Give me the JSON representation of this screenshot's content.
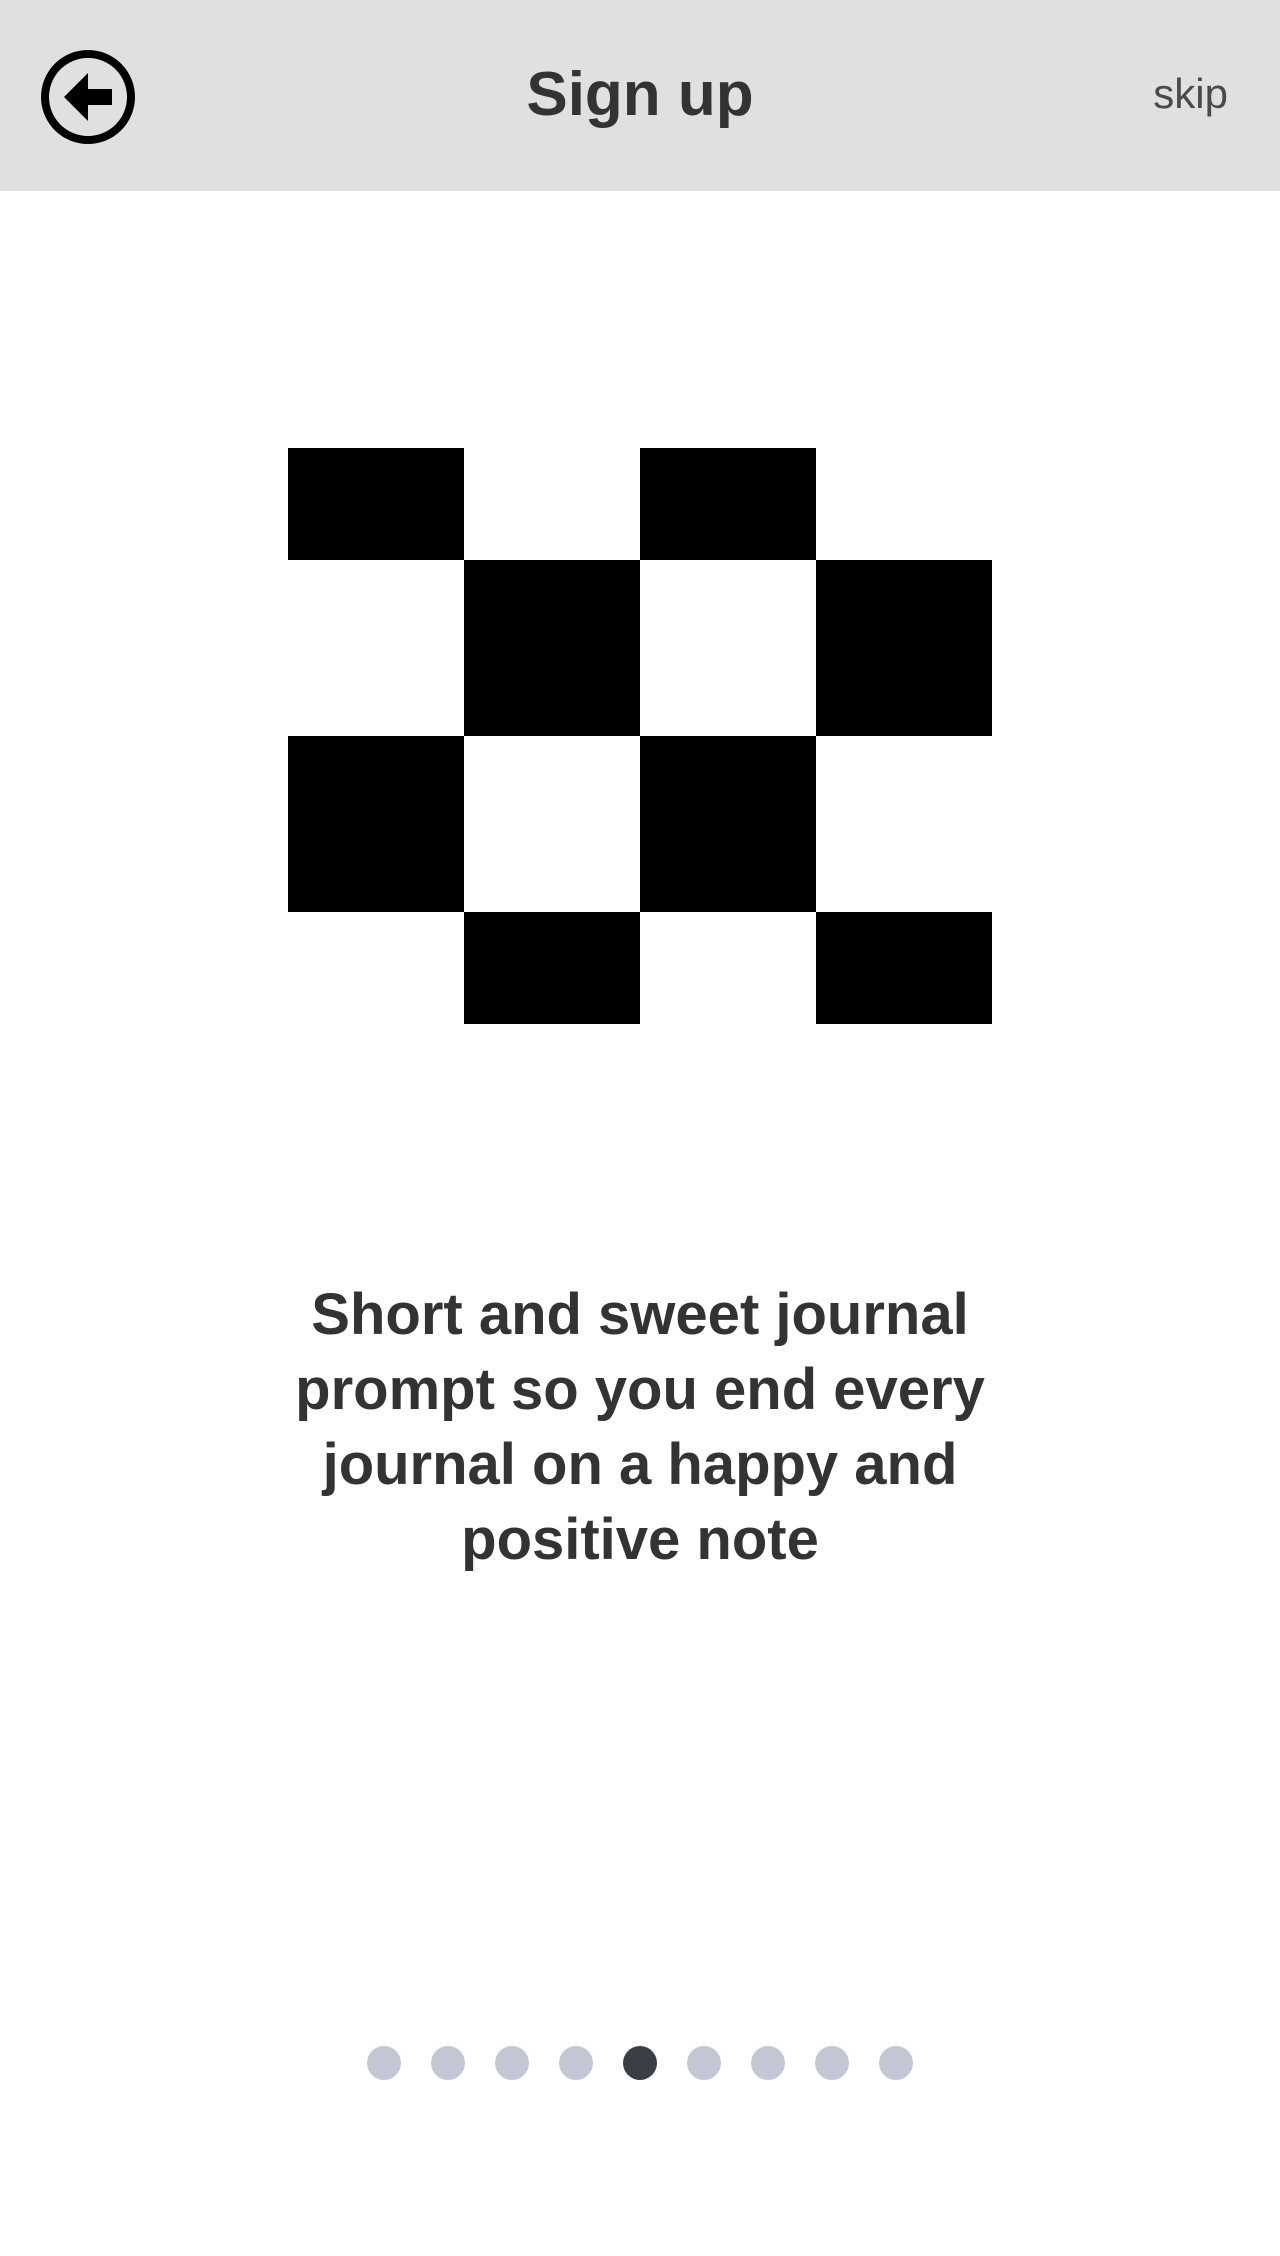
{
  "header": {
    "title": "Sign up",
    "skip_label": "skip"
  },
  "onboarding": {
    "message": "Short and sweet journal prompt so you end every journal on a happy and positive note"
  },
  "pager": {
    "total": 9,
    "current": 5
  },
  "colors": {
    "header_bg": "#e0e0e0",
    "text": "#333333",
    "dot_inactive": "#c3c8d4",
    "dot_active": "#3b3e47"
  }
}
